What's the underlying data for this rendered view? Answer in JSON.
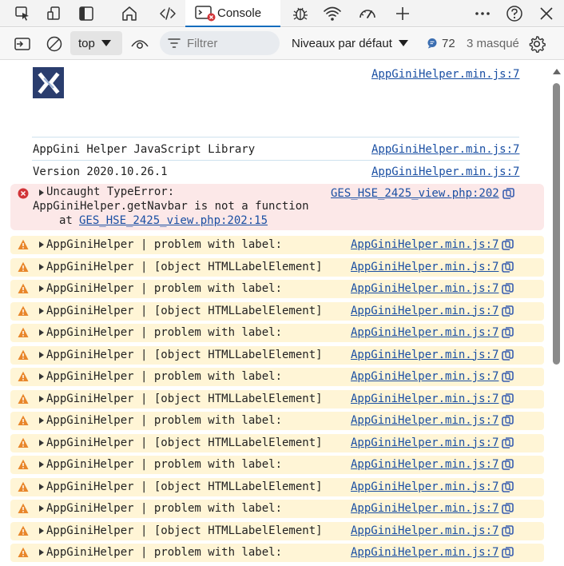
{
  "tabbar": {
    "console_tab_label": "Console",
    "icons": [
      "inspect-icon",
      "device-emulation-icon",
      "dock-icon",
      "welcome-home-icon",
      "elements-icon",
      "console-icon",
      "issues-bug-icon",
      "network-wifi-icon",
      "performance-gauge-icon",
      "add-tool-icon",
      "more-icon",
      "help-icon",
      "close-icon"
    ]
  },
  "toolbar": {
    "context": "top",
    "filter_placeholder": "Filtrer",
    "levels": "Niveaux par défaut",
    "message_count": "72",
    "hidden_count": "3 masqué"
  },
  "console": {
    "logo_source": "AppGiniHelper.min.js:7",
    "library_line": {
      "text": "AppGini Helper JavaScript Library",
      "source": "AppGiniHelper.min.js:7"
    },
    "version_line": {
      "text": "Version 2020.10.26.1",
      "source": "AppGiniHelper.min.js:7"
    },
    "error": {
      "title": "Uncaught TypeError:",
      "message": "AppGiniHelper.getNavbar is not a function",
      "at_prefix": "at",
      "at_link": "GES_HSE_2425_view.php:202:15",
      "source": "GES_HSE_2425_view.php:202"
    },
    "warnings": [
      {
        "text": "AppGiniHelper | problem with label:",
        "source": "AppGiniHelper.min.js:7"
      },
      {
        "text": "AppGiniHelper | [object HTMLLabelElement]",
        "source": "AppGiniHelper.min.js:7"
      },
      {
        "text": "AppGiniHelper | problem with label:",
        "source": "AppGiniHelper.min.js:7"
      },
      {
        "text": "AppGiniHelper | [object HTMLLabelElement]",
        "source": "AppGiniHelper.min.js:7"
      },
      {
        "text": "AppGiniHelper | problem with label:",
        "source": "AppGiniHelper.min.js:7"
      },
      {
        "text": "AppGiniHelper | [object HTMLLabelElement]",
        "source": "AppGiniHelper.min.js:7"
      },
      {
        "text": "AppGiniHelper | problem with label:",
        "source": "AppGiniHelper.min.js:7"
      },
      {
        "text": "AppGiniHelper | [object HTMLLabelElement]",
        "source": "AppGiniHelper.min.js:7"
      },
      {
        "text": "AppGiniHelper | problem with label:",
        "source": "AppGiniHelper.min.js:7"
      },
      {
        "text": "AppGiniHelper | [object HTMLLabelElement]",
        "source": "AppGiniHelper.min.js:7"
      },
      {
        "text": "AppGiniHelper | problem with label:",
        "source": "AppGiniHelper.min.js:7"
      },
      {
        "text": "AppGiniHelper | [object HTMLLabelElement]",
        "source": "AppGiniHelper.min.js:7"
      },
      {
        "text": "AppGiniHelper | problem with label:",
        "source": "AppGiniHelper.min.js:7"
      },
      {
        "text": "AppGiniHelper | [object HTMLLabelElement]",
        "source": "AppGiniHelper.min.js:7"
      },
      {
        "text": "AppGiniHelper | problem with label:",
        "source": "AppGiniHelper.min.js:7"
      }
    ]
  },
  "colors": {
    "link": "#1a4fa3",
    "error_bg": "#fce8e8",
    "warning_bg": "#fff5d6",
    "warning_icon": "#e8862a",
    "error_icon": "#d13438",
    "accent": "#0f6cbd"
  }
}
